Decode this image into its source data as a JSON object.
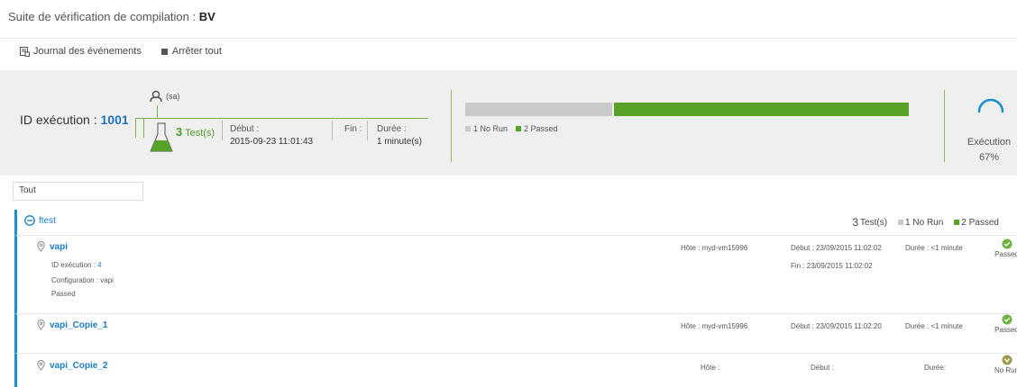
{
  "header": {
    "title_prefix": "Suite de vérification de compilation : ",
    "title_name": "BV"
  },
  "toolbar": {
    "event_log_label": "Journal des événements",
    "stop_all_label": "Arrêter tout"
  },
  "summary": {
    "exec_id_label": "ID exécution : ",
    "exec_id": "1001",
    "user": "(sa)",
    "test_count": "3",
    "test_count_suffix": " Test(s)",
    "start_label": "Début :",
    "start_value": "2015-09-23 11:01:43",
    "end_label": "Fin :",
    "duration_label": "Durée :",
    "duration_value": "1 minute(s)",
    "bar": {
      "no_run_fraction": 0.333,
      "passed_fraction": 0.667
    },
    "legend_no_run": "1 No Run",
    "legend_passed": "2 Passed",
    "exec_status_label": "Exécution",
    "exec_progress": "67%",
    "colors": {
      "no_run": "#c9c9c9",
      "passed": "#58a22a",
      "accent": "#1c8fd2"
    }
  },
  "filter": {
    "value": "Tout"
  },
  "group": {
    "name": "ftest",
    "test_count": "3",
    "test_count_suffix": " Test(s)",
    "legend_no_run": "1 No Run",
    "legend_passed": "2 Passed"
  },
  "rows": [
    {
      "name": "vapi",
      "exec_id_label": "ID exécution : ",
      "exec_id": "4",
      "config_label": "Configuration : ",
      "config": "vapi",
      "detail_status": "Passed",
      "host_label": "Hôte : ",
      "host": "myd-vm15996",
      "start_label": "Début : ",
      "start": "23/09/2015 11:02:02",
      "end_label": "Fin : ",
      "end": "23/09/2015 11:02:02",
      "duration_label": "Durée : ",
      "duration": "<1 minute",
      "status": "Passed",
      "status_icon": "check-circle-icon"
    },
    {
      "name": "vapi_Copie_1",
      "host_label": "Hôte : ",
      "host": "myd-vm15996",
      "start_label": "Début : ",
      "start": "23/09/2015 11:02:20",
      "duration_label": "Durée : ",
      "duration": "<1 minute",
      "status": "Passed",
      "status_icon": "check-circle-icon"
    },
    {
      "name": "vapi_Copie_2",
      "host_label": "Hôte :",
      "start_label": "Début :",
      "duration_label": "Durée:",
      "status": "No Run",
      "status_icon": "no-run-icon"
    }
  ]
}
